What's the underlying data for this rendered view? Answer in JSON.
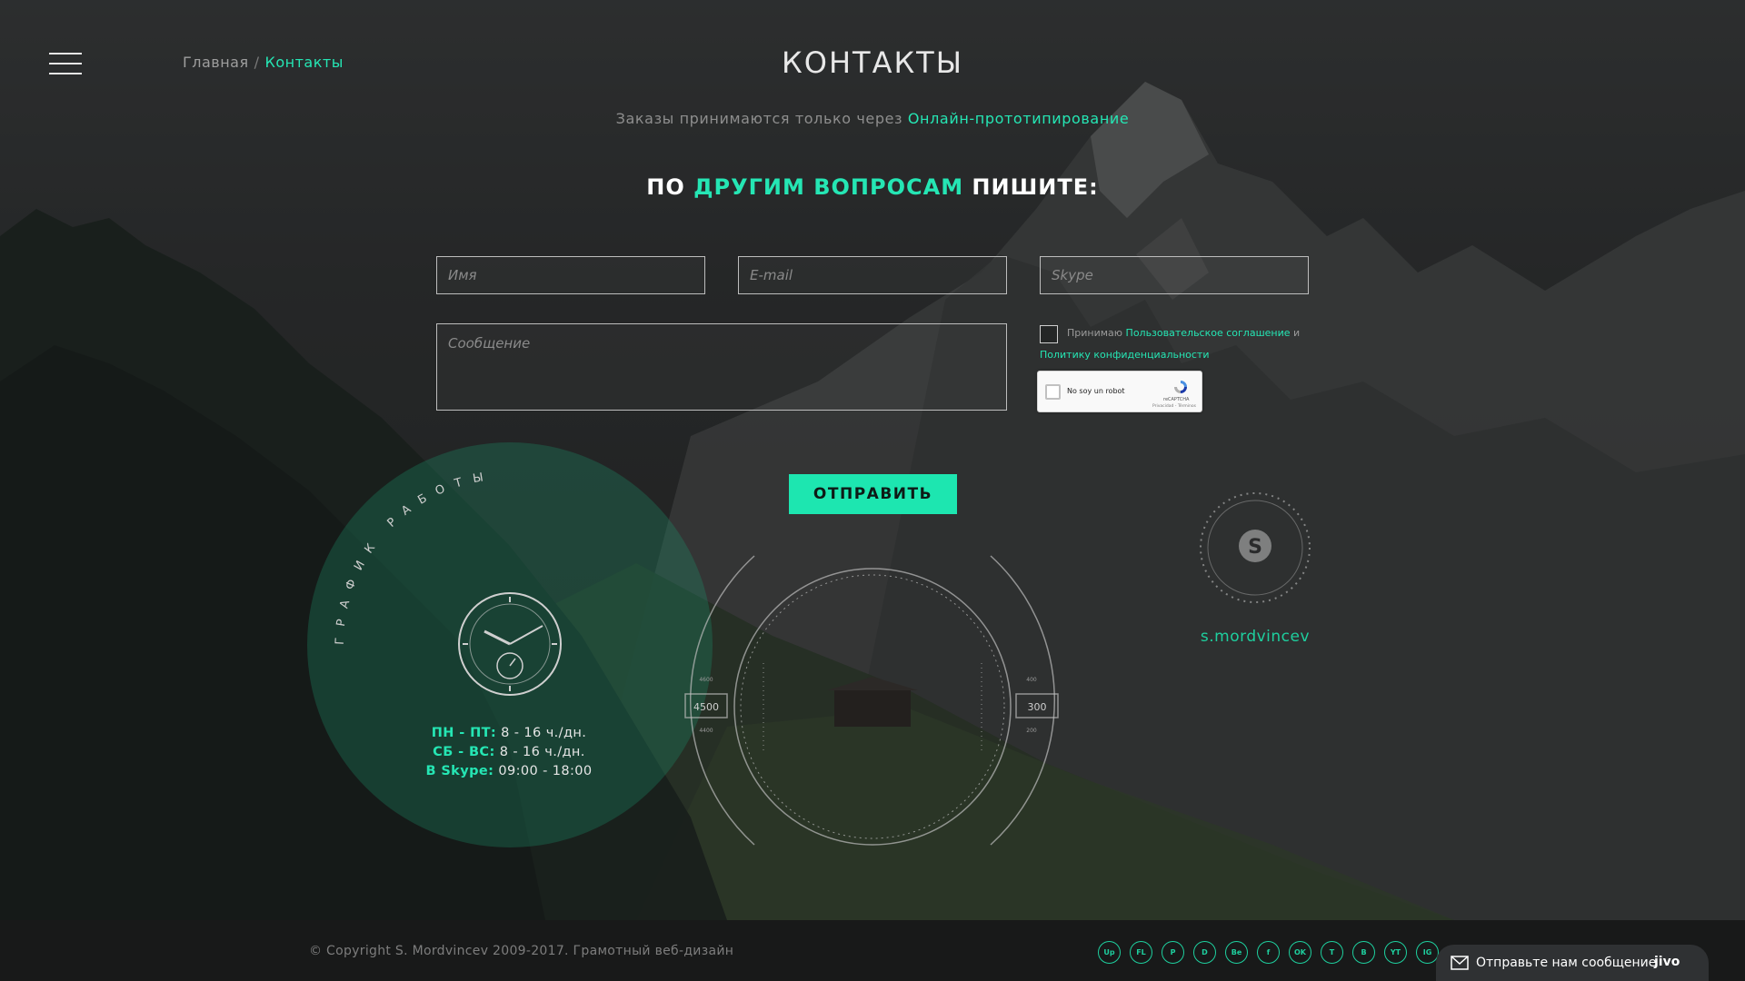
{
  "header": {
    "breadcrumb": {
      "home": "Главная",
      "separator": "/",
      "current": "Контакты"
    },
    "title": "КОНТАКТЫ"
  },
  "notice": {
    "text": "Заказы принимаются только через ",
    "link": "Онлайн-прототипирование"
  },
  "heading": {
    "part1": "ПО ",
    "highlight": "ДРУГИМ ВОПРОСАМ",
    "part2": " ПИШИТЕ:"
  },
  "form": {
    "name_placeholder": "Имя",
    "email_placeholder": "E-mail",
    "skype_placeholder": "Skype",
    "message_placeholder": "Сообщение",
    "agree_prefix": "Принимаю ",
    "agree_link1": "Пользовательское соглашение",
    "agree_and": " и",
    "agree_link2": "Политику конфиденциальности",
    "recaptcha_label": "No soy un robot",
    "recaptcha_brand": "reCAPTCHA",
    "recaptcha_terms": "Privacidad - Términos",
    "submit_label": "ОТПРАВИТЬ"
  },
  "schedule": {
    "arc_title": "ГРАФИК РАБОТЫ",
    "rows": [
      {
        "key": "ПН - ПТ:",
        "value": "8 - 16 ч./дн."
      },
      {
        "key": "СБ - ВС:",
        "value": "8 - 16 ч./дн."
      },
      {
        "key": "В Skype:",
        "value": "09:00 - 18:00"
      }
    ]
  },
  "gauge": {
    "left_value": "4500",
    "right_value": "300",
    "left_top": "4600",
    "left_bottom": "4400",
    "right_top": "400",
    "right_bottom": "200"
  },
  "skype": {
    "username": "s.mordvincev"
  },
  "footer": {
    "copyright": "© Copyright S. Mordvincev 2009-2017. Грамотный веб-дизайн",
    "socials": [
      "Up",
      "FL",
      "P",
      "D",
      "Be",
      "f",
      "OK",
      "T",
      "B",
      "YT",
      "IG"
    ],
    "chat_label": "Отправьте нам сообщение",
    "chat_brand": "jivo"
  },
  "colors": {
    "accent": "#25e6b4",
    "button": "#1de6b0",
    "footer": "#181919"
  }
}
